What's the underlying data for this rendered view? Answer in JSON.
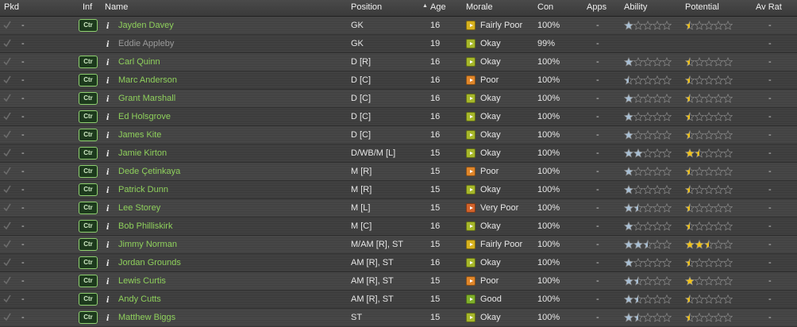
{
  "columns": {
    "pkd": "Pkd",
    "inf": "Inf",
    "name": "Name",
    "position": "Position",
    "age": "Age",
    "morale": "Morale",
    "con": "Con",
    "apps": "Apps",
    "ability": "Ability",
    "potential": "Potential",
    "av_rat": "Av Rat"
  },
  "sort_indicator": "▲",
  "colors": {
    "name_green": "#8fd15c",
    "ability_star": "#a8bfd4",
    "potential_star": "#f2c316",
    "morale_okay": "#a6b72a",
    "morale_fairly_poor": "#d7b21e",
    "morale_poor": "#e0862a",
    "morale_very_poor": "#d2622a",
    "morale_good": "#7faf2a"
  },
  "players": [
    {
      "pkd": "-",
      "inf": "Ctr",
      "name": "Jayden Davey",
      "position": "GK",
      "age": "16",
      "morale": "Fairly Poor",
      "morale_color": "#d7b21e",
      "con": "100%",
      "apps": "-",
      "ability": 1,
      "potential": 0.5,
      "av_rat": "-",
      "dim": false
    },
    {
      "pkd": "-",
      "inf": "",
      "name": "Eddie Appleby",
      "position": "GK",
      "age": "19",
      "morale": "Okay",
      "morale_color": "#a6b72a",
      "con": "99%",
      "apps": "-",
      "ability": null,
      "potential": null,
      "av_rat": "-",
      "dim": true
    },
    {
      "pkd": "-",
      "inf": "Ctr",
      "name": "Carl Quinn",
      "position": "D [R]",
      "age": "16",
      "morale": "Okay",
      "morale_color": "#a6b72a",
      "con": "100%",
      "apps": "-",
      "ability": 1,
      "potential": 0.5,
      "av_rat": "-",
      "dim": false
    },
    {
      "pkd": "-",
      "inf": "Ctr",
      "name": "Marc Anderson",
      "position": "D [C]",
      "age": "16",
      "morale": "Poor",
      "morale_color": "#e0862a",
      "con": "100%",
      "apps": "-",
      "ability": 0.5,
      "potential": 0.5,
      "av_rat": "-",
      "dim": false
    },
    {
      "pkd": "-",
      "inf": "Ctr",
      "name": "Grant Marshall",
      "position": "D [C]",
      "age": "16",
      "morale": "Okay",
      "morale_color": "#a6b72a",
      "con": "100%",
      "apps": "-",
      "ability": 1,
      "potential": 0.5,
      "av_rat": "-",
      "dim": false
    },
    {
      "pkd": "-",
      "inf": "Ctr",
      "name": "Ed Holsgrove",
      "position": "D [C]",
      "age": "16",
      "morale": "Okay",
      "morale_color": "#a6b72a",
      "con": "100%",
      "apps": "-",
      "ability": 1,
      "potential": 0.5,
      "av_rat": "-",
      "dim": false
    },
    {
      "pkd": "-",
      "inf": "Ctr",
      "name": "James Kite",
      "position": "D [C]",
      "age": "16",
      "morale": "Okay",
      "morale_color": "#a6b72a",
      "con": "100%",
      "apps": "-",
      "ability": 1,
      "potential": 0.5,
      "av_rat": "-",
      "dim": false
    },
    {
      "pkd": "-",
      "inf": "Ctr",
      "name": "Jamie Kirton",
      "position": "D/WB/M [L]",
      "age": "15",
      "morale": "Okay",
      "morale_color": "#a6b72a",
      "con": "100%",
      "apps": "-",
      "ability": 2,
      "potential": 1.5,
      "av_rat": "-",
      "dim": false
    },
    {
      "pkd": "-",
      "inf": "Ctr",
      "name": "Dede Çetinkaya",
      "position": "M [R]",
      "age": "15",
      "morale": "Poor",
      "morale_color": "#e0862a",
      "con": "100%",
      "apps": "-",
      "ability": 1,
      "potential": 0.5,
      "av_rat": "-",
      "dim": false
    },
    {
      "pkd": "-",
      "inf": "Ctr",
      "name": "Patrick Dunn",
      "position": "M [R]",
      "age": "15",
      "morale": "Okay",
      "morale_color": "#a6b72a",
      "con": "100%",
      "apps": "-",
      "ability": 1,
      "potential": 0.5,
      "av_rat": "-",
      "dim": false
    },
    {
      "pkd": "-",
      "inf": "Ctr",
      "name": "Lee Storey",
      "position": "M [L]",
      "age": "15",
      "morale": "Very Poor",
      "morale_color": "#d2622a",
      "con": "100%",
      "apps": "-",
      "ability": 1.5,
      "potential": 0.5,
      "av_rat": "-",
      "dim": false
    },
    {
      "pkd": "-",
      "inf": "Ctr",
      "name": "Bob Philliskirk",
      "position": "M [C]",
      "age": "16",
      "morale": "Okay",
      "morale_color": "#a6b72a",
      "con": "100%",
      "apps": "-",
      "ability": 1,
      "potential": 0.5,
      "av_rat": "-",
      "dim": false
    },
    {
      "pkd": "-",
      "inf": "Ctr",
      "name": "Jimmy Norman",
      "position": "M/AM [R], ST",
      "age": "15",
      "morale": "Fairly Poor",
      "morale_color": "#d7b21e",
      "con": "100%",
      "apps": "-",
      "ability": 2.5,
      "potential": 2.5,
      "av_rat": "-",
      "dim": false
    },
    {
      "pkd": "-",
      "inf": "Ctr",
      "name": "Jordan Grounds",
      "position": "AM [R], ST",
      "age": "16",
      "morale": "Okay",
      "morale_color": "#a6b72a",
      "con": "100%",
      "apps": "-",
      "ability": 1,
      "potential": 0.5,
      "av_rat": "-",
      "dim": false
    },
    {
      "pkd": "-",
      "inf": "Ctr",
      "name": "Lewis Curtis",
      "position": "AM [R], ST",
      "age": "15",
      "morale": "Poor",
      "morale_color": "#e0862a",
      "con": "100%",
      "apps": "-",
      "ability": 1.5,
      "potential": 1,
      "av_rat": "-",
      "dim": false
    },
    {
      "pkd": "-",
      "inf": "Ctr",
      "name": "Andy Cutts",
      "position": "AM [R], ST",
      "age": "15",
      "morale": "Good",
      "morale_color": "#7faf2a",
      "con": "100%",
      "apps": "-",
      "ability": 1.5,
      "potential": 0.5,
      "av_rat": "-",
      "dim": false
    },
    {
      "pkd": "-",
      "inf": "Ctr",
      "name": "Matthew Biggs",
      "position": "ST",
      "age": "15",
      "morale": "Okay",
      "morale_color": "#a6b72a",
      "con": "100%",
      "apps": "-",
      "ability": 1.5,
      "potential": 0.5,
      "av_rat": "-",
      "dim": false
    }
  ]
}
